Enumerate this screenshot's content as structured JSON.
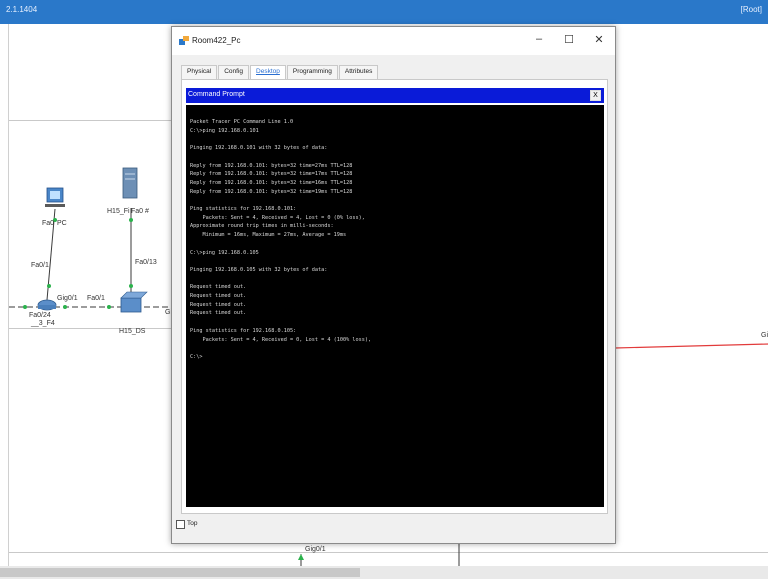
{
  "app": {
    "title": "2.1.1404",
    "root_label": "[Root]"
  },
  "window": {
    "title": "Room422_Pc",
    "tabs": [
      {
        "label": "Physical"
      },
      {
        "label": "Config"
      },
      {
        "label": "Desktop",
        "active": true
      },
      {
        "label": "Programming"
      },
      {
        "label": "Attributes"
      }
    ],
    "minimize_symbol": "–",
    "maximize_symbol": "☐",
    "close_symbol": "✕",
    "top_checkbox_label": "Top"
  },
  "command_prompt": {
    "title": "Command Prompt",
    "close_symbol": "X",
    "lines": [
      "Packet Tracer PC Command Line 1.0",
      "C:\\>ping 192.168.0.101",
      "",
      "Pinging 192.168.0.101 with 32 bytes of data:",
      "",
      "Reply from 192.168.0.101: bytes=32 time=27ms TTL=128",
      "Reply from 192.168.0.101: bytes=32 time=17ms TTL=128",
      "Reply from 192.168.0.101: bytes=32 time=16ms TTL=128",
      "Reply from 192.168.0.101: bytes=32 time=19ms TTL=128",
      "",
      "Ping statistics for 192.168.0.101:",
      "    Packets: Sent = 4, Received = 4, Lost = 0 (0% loss),",
      "Approximate round trip times in milli-seconds:",
      "    Minimum = 16ms, Maximum = 27ms, Average = 19ms",
      "",
      "C:\\>ping 192.168.0.105",
      "",
      "Pinging 192.168.0.105 with 32 bytes of data:",
      "",
      "Request timed out.",
      "Request timed out.",
      "Request timed out.",
      "Request timed out.",
      "",
      "Ping statistics for 192.168.0.105:",
      "    Packets: Sent = 4, Received = 0, Lost = 4 (100% loss),",
      "",
      "C:\\>"
    ]
  },
  "topology": {
    "labels": {
      "fa0_pc": "Fa0",
      "pc_label": "PC",
      "server_label": "H15_Fi",
      "server_port": "Fa0 #",
      "fa0_1_left": "Fa0/1",
      "fa0_13": "Fa0/13",
      "gig0_1_a": "Gig0/1",
      "fa0_1_mid": "Fa0/1",
      "fa0_24": "Fa0/24",
      "router_f4": "__3_F4",
      "switch_ds": "H15_DS",
      "gi_cut": "Gi",
      "gi_right": "Gi",
      "gig0_1_bottom": "Gig0/1"
    },
    "colors": {
      "link_black": "#3a3a3a",
      "link_red": "#e23b3b",
      "port_green": "#2bb24c",
      "device_blue": "#4a86c8"
    }
  }
}
